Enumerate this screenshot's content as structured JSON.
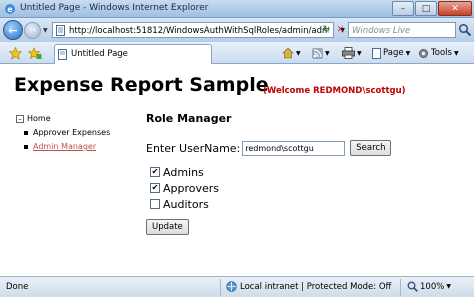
{
  "window": {
    "title": "Untitled Page - Windows Internet Explorer"
  },
  "addressbar": {
    "url": "http://localhost:51812/WindowsAuthWithSqlRoles/admin/adm",
    "search_placeholder": "Windows Live"
  },
  "tabbar": {
    "tab_label": "Untitled Page",
    "page_menu": "Page",
    "tools_menu": "Tools"
  },
  "page": {
    "heading": "Expense Report Sample",
    "welcome": "(Welcome REDMOND\\scottgu)",
    "nav": {
      "root": "Home",
      "items": [
        "Approver Expenses",
        "Admin Manager"
      ]
    },
    "role_manager": {
      "title": "Role Manager",
      "username_label": "Enter UserName:",
      "username_value": "redmond\\scottgu",
      "search_button": "Search",
      "roles": [
        {
          "name": "Admins",
          "checked": true
        },
        {
          "name": "Approvers",
          "checked": true
        },
        {
          "name": "Auditors",
          "checked": false
        }
      ],
      "update_button": "Update"
    }
  },
  "statusbar": {
    "status": "Done",
    "zone": "Local intranet | Protected Mode: Off",
    "zoom": "100%"
  }
}
